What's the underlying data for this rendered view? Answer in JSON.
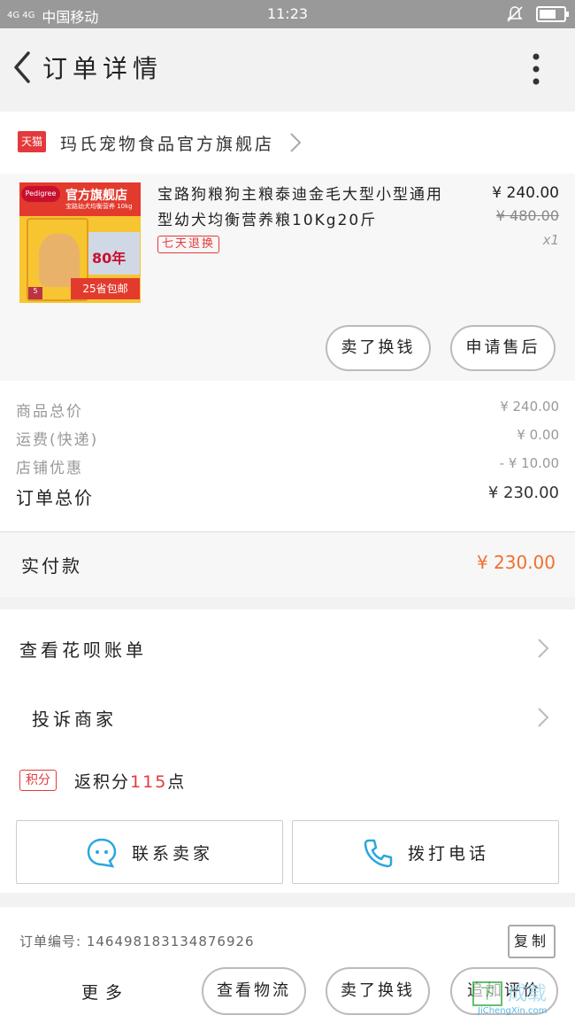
{
  "status_bar": {
    "signal_text": "4G 4G",
    "carrier": "中国移动",
    "time": "11:23",
    "icons": [
      "signal-icon",
      "mute-icon",
      "battery-icon"
    ],
    "battery_level": 0.7
  },
  "header": {
    "title": "订单详情",
    "back_icon": "chevron-left-icon",
    "more_icon": "vertical-dots-icon"
  },
  "store": {
    "badge": "天猫",
    "name": "玛氏宠物食品官方旗舰店",
    "icon": "chevron-right-icon"
  },
  "product": {
    "image": {
      "brand": "Pedigree",
      "banner": "官方旗舰店",
      "sub": "宝路幼犬均衡营养 10kg",
      "seal_text": "80年",
      "promo": "25省包邮",
      "tag": "5"
    },
    "title": "宝路狗粮狗主粮泰迪金毛大型小型通用型幼犬均衡营养粮10Kg20斤",
    "return_badge": "七天退换",
    "price": "¥ 240.00",
    "original_price": "¥ 480.00",
    "quantity": "x1",
    "actions": {
      "sold": "卖了换钱",
      "aftersale": "申请售后"
    }
  },
  "summary": {
    "rows": [
      {
        "label": "商品总价",
        "value": "¥ 240.00"
      },
      {
        "label": "运费(快递)",
        "value": "¥ 0.00"
      },
      {
        "label": "店铺优惠",
        "value": "- ¥ 10.00"
      }
    ],
    "total_label": "订单总价",
    "total_value": "¥ 230.00"
  },
  "paid": {
    "label": "实付款",
    "value": "¥ 230.00"
  },
  "links": {
    "huabei": "查看花呗账单",
    "complain": "投诉商家",
    "points_badge": "积分",
    "points_prefix": "返积分",
    "points_num": "115",
    "points_suffix": "点"
  },
  "contact": {
    "chat_label": "联系卖家",
    "chat_icon": "chat-bubble-icon",
    "call_label": "拨打电话",
    "call_icon": "phone-icon",
    "accent": "#2aa6e0"
  },
  "order": {
    "number_label": "订单编号: 1464981831348769​26",
    "copy": "复制"
  },
  "bottom": {
    "more": "更多",
    "logistics": "查看物流",
    "sold": "卖了换钱",
    "review": "追加评价"
  },
  "watermark": {
    "box": "下",
    "cn": "成载",
    "url": "JiChengXin.com"
  },
  "colors": {
    "accent_red": "#e4393c",
    "price_orange": "#f07030",
    "status_gray": "#999999"
  }
}
